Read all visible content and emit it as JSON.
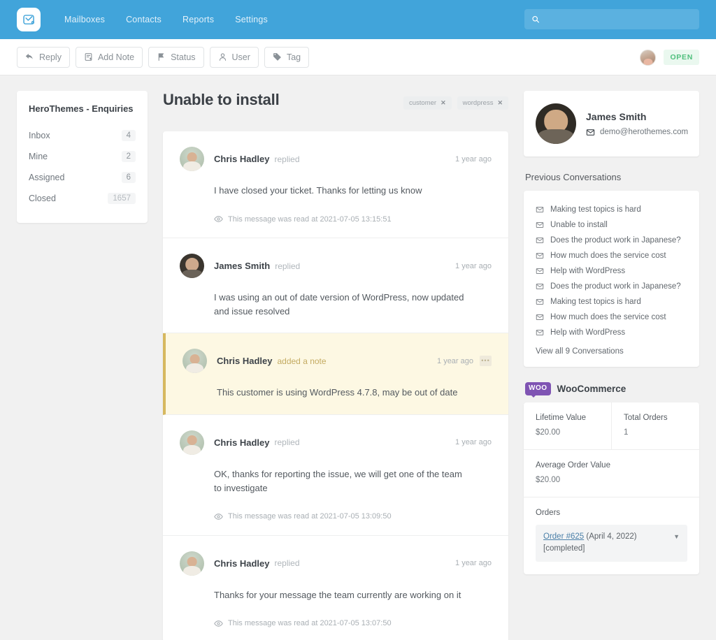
{
  "topnav": {
    "logo_icon": "envelope-check-logo",
    "links": [
      "Mailboxes",
      "Contacts",
      "Reports",
      "Settings"
    ],
    "search": {
      "placeholder": "",
      "value": "",
      "icon": "search-icon"
    }
  },
  "toolbar": {
    "buttons": [
      {
        "label": "Reply",
        "icon": "reply-arrow-icon"
      },
      {
        "label": "Add Note",
        "icon": "note-plus-icon"
      },
      {
        "label": "Status",
        "icon": "flag-icon"
      },
      {
        "label": "User",
        "icon": "person-icon"
      },
      {
        "label": "Tag",
        "icon": "tag-icon"
      }
    ],
    "assignee_avatar": "agent-avatar",
    "status_badge": "OPEN"
  },
  "sidebar": {
    "title": "HeroThemes - Enquiries",
    "items": [
      {
        "label": "Inbox",
        "count": "4",
        "dim": false
      },
      {
        "label": "Mine",
        "count": "2",
        "dim": false
      },
      {
        "label": "Assigned",
        "count": "6",
        "dim": false
      },
      {
        "label": "Closed",
        "count": "1657",
        "dim": true
      }
    ]
  },
  "conversation": {
    "title": "Unable to install",
    "tags": [
      {
        "label": "customer",
        "remove": "✕"
      },
      {
        "label": "wordpress",
        "remove": "✕"
      }
    ],
    "messages": [
      {
        "author": "Chris Hadley",
        "action": "replied",
        "time": "1 year ago",
        "body": "I have closed your ticket. Thanks for letting us know",
        "read": "This message was read at 2021-07-05 13:15:51",
        "avatar": "chris",
        "is_note": false,
        "has_menu": false
      },
      {
        "author": "James Smith",
        "action": "replied",
        "time": "1 year ago",
        "body": "I was using an out of date version of WordPress, now updated and issue resolved",
        "read": "",
        "avatar": "james",
        "is_note": false,
        "has_menu": false
      },
      {
        "author": "Chris Hadley",
        "action": "added a note",
        "time": "1 year ago",
        "body": "This customer is using WordPress 4.7.8, may be out of date",
        "read": "",
        "avatar": "chris",
        "is_note": true,
        "has_menu": true,
        "menu_label": "•••"
      },
      {
        "author": "Chris Hadley",
        "action": "replied",
        "time": "1 year ago",
        "body": "OK, thanks for reporting the issue, we will get one of the team to investigate",
        "read": "This message was read at 2021-07-05 13:09:50",
        "avatar": "chris",
        "is_note": false,
        "has_menu": false
      },
      {
        "author": "Chris Hadley",
        "action": "replied",
        "time": "1 year ago",
        "body": "Thanks for your message the team currently are working on it",
        "read": "This message was read at 2021-07-05 13:07:50",
        "avatar": "chris",
        "is_note": false,
        "has_menu": false
      }
    ]
  },
  "customer": {
    "name": "James Smith",
    "email": "demo@herothemes.com",
    "email_icon": "envelope-icon",
    "avatar": "james-photo"
  },
  "previous_conversations": {
    "heading": "Previous Conversations",
    "items": [
      "Making test topics is hard",
      "Unable to install",
      "Does the product work in Japanese?",
      "How much does the service cost",
      "Help with WordPress",
      "Does the product work in Japanese?",
      "Making test topics is hard",
      "How much does the service cost",
      "Help with WordPress"
    ],
    "view_all": "View all 9 Conversations"
  },
  "woocommerce": {
    "brand_mark": "WOO",
    "title": "WooCommerce",
    "accent_color": "#7f54b3",
    "lifetime_value_label": "Lifetime Value",
    "lifetime_value": "$20.00",
    "total_orders_label": "Total Orders",
    "total_orders": "1",
    "average_order_label": "Average Order Value",
    "average_order_value": "$20.00",
    "orders_label": "Orders",
    "order": {
      "link": "Order #625",
      "date": " (April 4, 2022)",
      "status": "[completed]",
      "caret": "▼"
    }
  },
  "colors": {
    "brand_blue": "#41a4da",
    "page_bg": "#f1f1f1",
    "note_bg": "#fdf8e3",
    "note_border": "#d6b85f",
    "open_green": "#4fbf7c"
  }
}
